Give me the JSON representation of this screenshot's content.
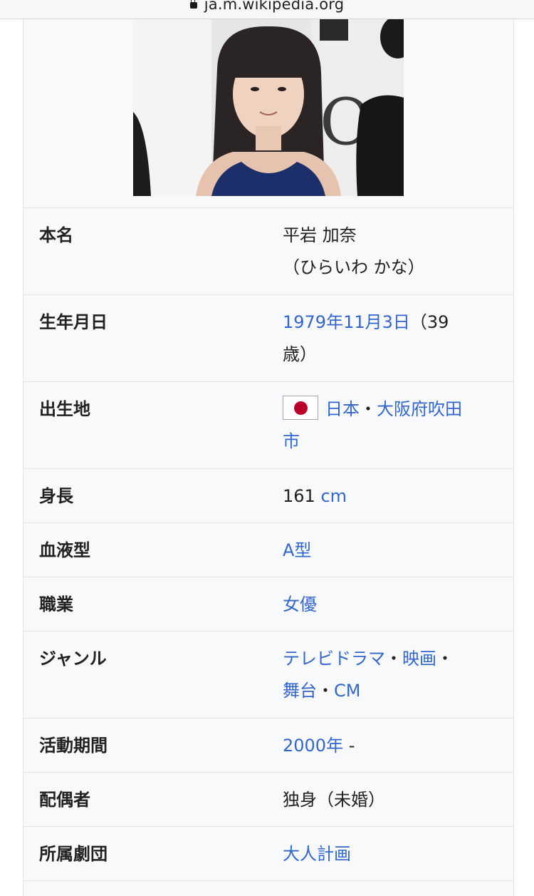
{
  "browser": {
    "url": "ja.m.wikipedia.org"
  },
  "colors": {
    "link": "#3366cc",
    "infobox_bg": "#f8f9fa",
    "flag_red": "#bc002d"
  },
  "infobox": {
    "rows": [
      {
        "label": "本名",
        "value_line1": "平岩 加奈",
        "value_line2": "（ひらいわ かな）"
      },
      {
        "label": "生年月日",
        "birth_link": "1979年11月3日",
        "age_text_a": "（39",
        "age_text_b": "歳）"
      },
      {
        "label": "出生地",
        "country_link": "日本",
        "sep": "・",
        "place_link_a": "大阪府吹田",
        "place_link_b": "市"
      },
      {
        "label": "身長",
        "value": "161",
        "unit_link": "cm"
      },
      {
        "label": "血液型",
        "value_link": "A型"
      },
      {
        "label": "職業",
        "value_link": "女優"
      },
      {
        "label": "ジャンル",
        "link_tv": "テレビドラマ",
        "sep1": "・",
        "link_film": "映画",
        "sep2": "・",
        "link_stage": "舞台",
        "sep3": "・",
        "link_cm": "CM"
      },
      {
        "label": "活動期間",
        "year_link": "2000年",
        "suffix": " -"
      },
      {
        "label": "配偶者",
        "value": "独身（未婚）"
      },
      {
        "label": "所属劇団",
        "value_link": "大人計画"
      }
    ]
  }
}
